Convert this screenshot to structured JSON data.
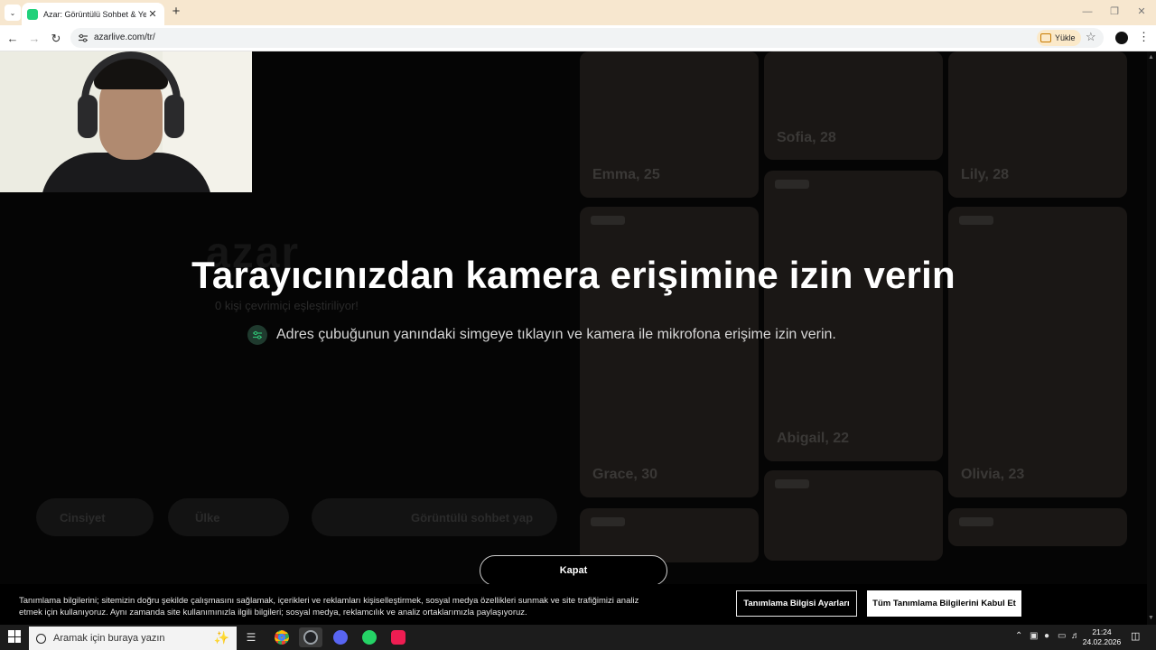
{
  "browser": {
    "tab_title": "Azar: Görüntülü Sohbet & Yeni",
    "url": "azarlive.com/tr/",
    "install_label": "Yükle"
  },
  "page": {
    "heading": "Tarayıcınızdan kamera erişimine izin verin",
    "instruction": "Adres çubuğunun yanındaki simgeye tıklayın ve kamera ile mikrofona erişime izin verin.",
    "close_label": "Kapat",
    "background": {
      "online_text": "0 kişi çevrimiçi eşleştiriliyor!",
      "gender_label": "Cinsiyet",
      "country_label": "Ülke",
      "start_label": "Görüntülü sohbet yap",
      "profiles": [
        {
          "label": "Emma, 25"
        },
        {
          "label": "Sofia, 28"
        },
        {
          "label": "Lily, 28"
        },
        {
          "label": "Abigail, 22"
        },
        {
          "label": "Grace, 30"
        },
        {
          "label": "Olivia, 23"
        }
      ]
    }
  },
  "cookie": {
    "text": "Tanımlama bilgilerini; sitemizin doğru şekilde çalışmasını sağlamak, içerikleri ve reklamları kişiselleştirmek, sosyal medya özellikleri sunmak ve site trafiğimizi analiz etmek için kullanıyoruz. Aynı zamanda site kullanımınızla ilgili bilgileri; sosyal medya, reklamcılık ve analiz ortaklarımızla paylaşıyoruz.",
    "settings_label": "Tanımlama Bilgisi Ayarları",
    "accept_label": "Tüm Tanımlama Bilgilerini Kabul Et"
  },
  "taskbar": {
    "search_placeholder": "Aramak için buraya yazın",
    "time": "21:24",
    "date": "24.02.2026"
  },
  "colors": {
    "brand": "#21d17a",
    "background": "#050505"
  }
}
